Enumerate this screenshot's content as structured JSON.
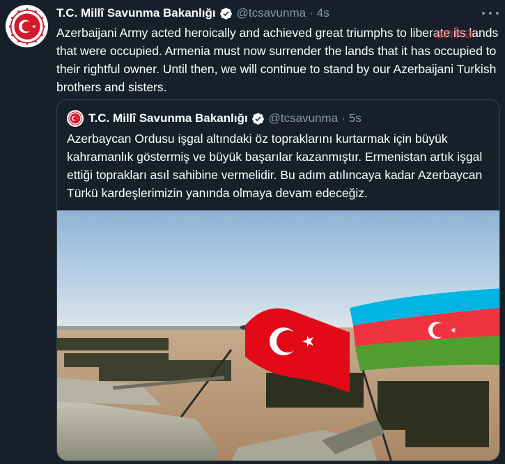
{
  "tweet": {
    "author_name": "T.C. Millî Savunma Bakanlığı",
    "handle": "@tcsavunma",
    "separator": "·",
    "time": "4s",
    "text": "Azerbaijani Army acted heroically and achieved great triumphs to liberate its lands that were occupied. Armenia must now surrender the lands that it has occupied to their rightful owner. Until then, we will continue to stand by our Azerbaijani Turkish brothers and sisters.",
    "watermark": "anka"
  },
  "quoted_tweet": {
    "author_name": "T.C. Millî Savunma Bakanlığı",
    "handle": "@tcsavunma",
    "separator": "·",
    "time": "5s",
    "text": "Azerbaycan Ordusu işgal altındaki öz topraklarını kurtarmak için büyük kahramanlık göstermiş ve büyük başarılar kazanmıştır. Ermenistan artık işgal ettiği toprakları asıl sahibine vermelidir. Bu adım atılıncaya kadar Azerbaycan Türkü kardeşlerimizin yanında olmaya devam edeceğiz."
  },
  "colors": {
    "background": "#15202b",
    "border": "#38444d",
    "secondary_text": "#8899a6",
    "verified": "#ffffff",
    "turkey_red": "#e30a17",
    "azerbaijan_blue": "#00b5e2",
    "azerbaijan_red": "#ef3340",
    "azerbaijan_green": "#509e2f"
  },
  "icons": {
    "verified": "verified-badge-icon",
    "more": "more-options-icon",
    "avatar": "ministry-emblem-logo"
  }
}
